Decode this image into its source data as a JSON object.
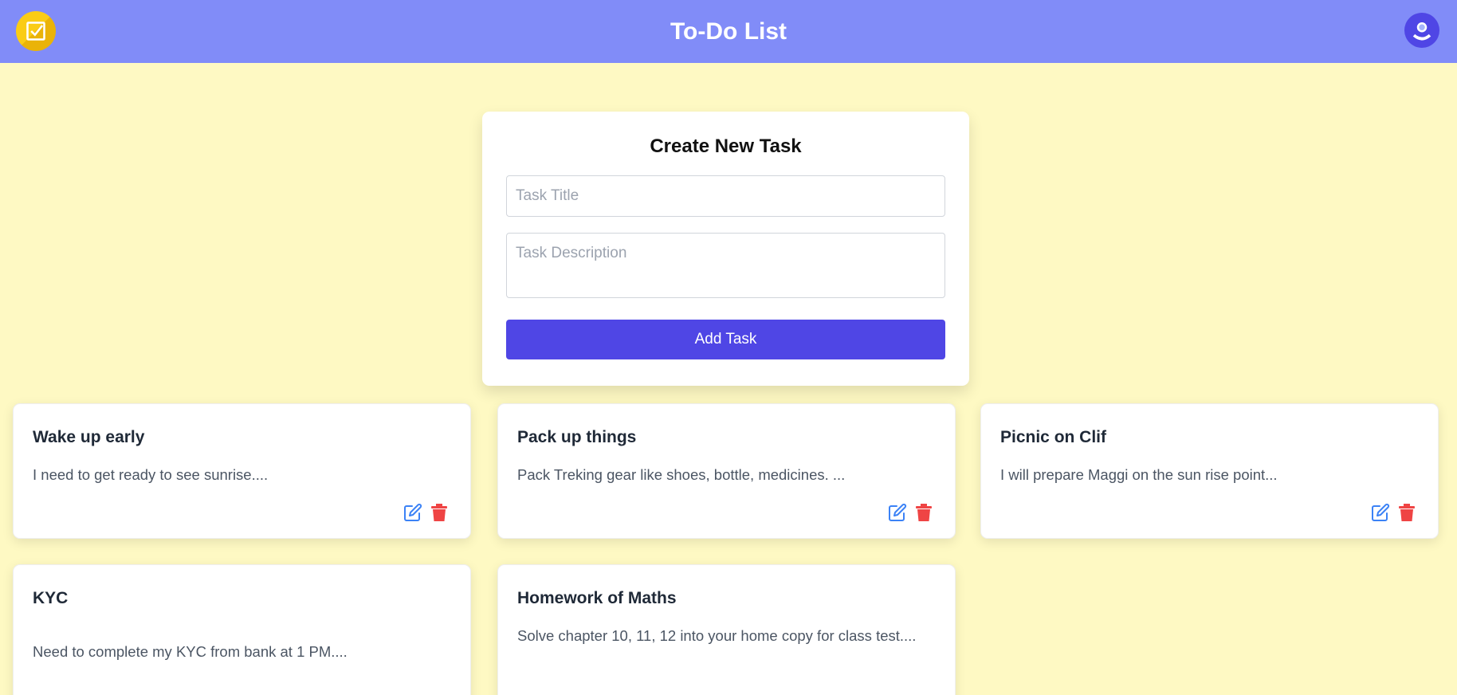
{
  "header": {
    "title": "To-Do List",
    "logo_icon": "checkbox-icon",
    "avatar_icon": "user-icon"
  },
  "form": {
    "title": "Create New Task",
    "title_placeholder": "Task Title",
    "description_placeholder": "Task Description",
    "submit_label": "Add Task"
  },
  "colors": {
    "header": "#818cf8",
    "background": "#fef9c3",
    "primary": "#4f46e5",
    "edit": "#3b82f6",
    "delete": "#ef4444"
  },
  "tasks": [
    {
      "title": "Wake up early",
      "description": "I need to get ready to see sunrise...."
    },
    {
      "title": "Pack up things",
      "description": "Pack Treking gear like shoes, bottle, medicines. ..."
    },
    {
      "title": "Picnic on Clif",
      "description": "I will prepare Maggi on the sun rise point..."
    },
    {
      "title": "KYC",
      "description": "Need to complete my KYC from bank at 1 PM...."
    },
    {
      "title": "Homework of Maths",
      "description": "Solve chapter 10, 11, 12 into your home copy for class test...."
    }
  ]
}
